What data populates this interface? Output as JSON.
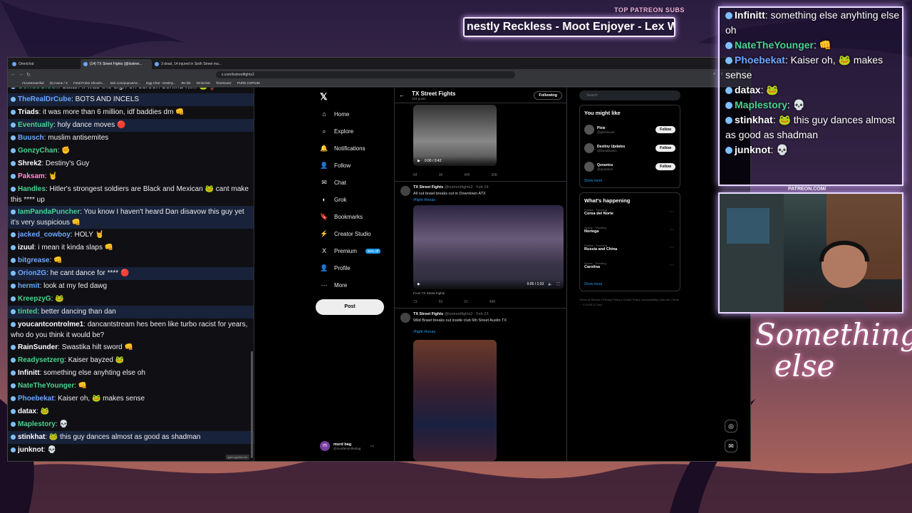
{
  "overlay": {
    "top_subs_label": "TOP PATREON SUBS",
    "ticker_text": "nestly Reckless - Moot Enjoyer - Lex W",
    "patreon_url": "PATREON.COM/",
    "logo_text": "Something else"
  },
  "browser": {
    "tabs": [
      {
        "label": "Omnichat",
        "active": false
      },
      {
        "label": "(14) TX Street Fights (@txstree...",
        "active": true
      },
      {
        "label": "3 dead, 14 injured in Sixth Street ma...",
        "active": false
      }
    ],
    "url": "x.com/txstreetfights2",
    "bookmarks": [
      "r/Livestreamfail",
      "(5) Home / X",
      "Fetal Police Shootin...",
      "kick.com/popout/xs...",
      "Ogg Chat - Destiny...",
      "the list",
      "Omnichat",
      "TimeGuesr",
      "PURE COPIUM"
    ]
  },
  "chat": {
    "messages": [
      {
        "user": "CondoSloth",
        "color": "#4ad28f",
        "text": "datax it was the sign on screen behind him 🐸🦆",
        "alt": false
      },
      {
        "user": "TheRealDrCube",
        "color": "#6aa8ff",
        "text": "BOTS AND INCELS",
        "alt": true
      },
      {
        "user": "Triads",
        "color": "#ffffff",
        "text": "it was more than 6 million, idf baddies dm 👊",
        "alt": false
      },
      {
        "user": "Eventually",
        "color": "#4ad28f",
        "text": "holy dance moves 🔴",
        "alt": true
      },
      {
        "user": "Buusch",
        "color": "#6aa8ff",
        "text": "muslim antisemites",
        "alt": false
      },
      {
        "user": "GonzyChan",
        "color": "#4ad28f",
        "text": "✊",
        "alt": false
      },
      {
        "user": "Shrek2",
        "color": "#ffffff",
        "text": "Destiny's Guy",
        "alt": false
      },
      {
        "user": "Paksam",
        "color": "#ff8fd0",
        "text": "🤘",
        "alt": false
      },
      {
        "user": "Handles",
        "color": "#4ad28f",
        "text": "Hitler's strongest soldiers are Black and Mexican 🐸 cant make this **** up",
        "alt": false,
        "wrap": true
      },
      {
        "user": "IamPandaPuncher",
        "color": "#4ad28f",
        "text": "You know I haven't heard Dan disavow this guy yet it's very suspicious 👊",
        "alt": true,
        "wrap": true
      },
      {
        "user": "jacked_cowboy",
        "color": "#6aa8ff",
        "text": "HOLY 🤘",
        "alt": false
      },
      {
        "user": "izuul",
        "color": "#ffffff",
        "text": "i mean it kinda slaps 👊",
        "alt": false
      },
      {
        "user": "bitgrease",
        "color": "#6aa8ff",
        "text": "👊",
        "alt": false
      },
      {
        "user": "Orion2G",
        "color": "#6aa8ff",
        "text": "he cant dance for **** 🔴",
        "alt": true
      },
      {
        "user": "hermit",
        "color": "#6aa8ff",
        "text": "look at my fed dawg",
        "alt": false
      },
      {
        "user": "KreepzyG",
        "color": "#4ad28f",
        "text": "🐸",
        "alt": false
      },
      {
        "user": "tinted",
        "color": "#4ad28f",
        "text": "better dancing than dan",
        "alt": true
      },
      {
        "user": "youcantcontrolme1",
        "color": "#ffffff",
        "text": "dancantstream hes been like turbo racist for years, who do you think it would be?",
        "alt": false,
        "wrap": true
      },
      {
        "user": "RainSunder",
        "color": "#ffffff",
        "text": "Swastika hilt sword 👊",
        "alt": false
      },
      {
        "user": "Readysetzerg",
        "color": "#4ad28f",
        "text": "Kaiser bayzed 🐸",
        "alt": false
      },
      {
        "user": "Infinitt",
        "color": "#ffffff",
        "text": "something else anyhting else oh",
        "alt": false
      },
      {
        "user": "NateTheYounger",
        "color": "#4ad28f",
        "text": "👊",
        "alt": false
      },
      {
        "user": "Phoebekat",
        "color": "#6aa8ff",
        "text": "Kaiser oh, 🐸 makes sense",
        "alt": false
      },
      {
        "user": "datax",
        "color": "#ffffff",
        "text": "🐸",
        "alt": false
      },
      {
        "user": "Maplestory",
        "color": "#4ad28f",
        "text": "💀",
        "alt": false
      },
      {
        "user": "stinkhat",
        "color": "#ffffff",
        "text": "🐸 this guy dances almost as good as shadman",
        "alt": true
      },
      {
        "user": "junknot",
        "color": "#ffffff",
        "text": "💀",
        "alt": false
      }
    ],
    "footer_badge": "gum.sypher.me"
  },
  "x": {
    "nav": [
      "Home",
      "Explore",
      "Notifications",
      "Follow",
      "Chat",
      "Grok",
      "Bookmarks",
      "Creator Studio",
      "Premium",
      "Profile",
      "More"
    ],
    "nav_icons": [
      "⌂",
      "⌕",
      "🔔",
      "👤",
      "✉",
      "◐",
      "🔖",
      "⚡",
      "X",
      "👤",
      "⋯"
    ],
    "premium_badge": "50% off",
    "post_label": "Post",
    "account": {
      "name": "murd bag",
      "handle": "@murdersinthebag",
      "initial": "m"
    },
    "header": {
      "title": "TX Street Fights",
      "posts": "334 posts",
      "following_label": "Following"
    },
    "tweets": [
      {
        "stats": [
          "84",
          "38",
          "445",
          "30K"
        ],
        "time": "0:00 / 0:42"
      },
      {
        "name": "TX Street Fights",
        "handle": "@txstreetfights2 · Feb 24",
        "text": "All out brawl breaks out in Downtown ATX",
        "tags": "#fight #texas",
        "time": "0:05 / 1:33",
        "from": "From TX Street Fights",
        "stats": [
          "73",
          "59",
          "91",
          "48K"
        ]
      },
      {
        "name": "TX Street Fights",
        "handle": "@txstreetfights2 · Feb 23",
        "text": "Wild Brawl breaks out inside club 6th Street Austin TX",
        "tags": "#fight #texas"
      }
    ],
    "search_placeholder": "Search",
    "you_might_like": {
      "title": "You might like",
      "accounts": [
        {
          "name": "Pixie",
          "handle": "@pixielovee",
          "follow": "Follow"
        },
        {
          "name": "Destiny Updates",
          "handle": "@DestiDanko",
          "follow": "Follow"
        },
        {
          "name": "Qorantos",
          "handle": "@qorantos",
          "follow": "Follow"
        }
      ],
      "show_more": "Show more"
    },
    "whats_happening": {
      "title": "What's happening",
      "trends": [
        {
          "cat": "Politics · Trending",
          "name": "Corea del Norte"
        },
        {
          "cat": "Sports · Trending",
          "name": "Noriega"
        },
        {
          "cat": "Politics · Trending",
          "name": "Russia and China"
        },
        {
          "cat": "Sports · Trending",
          "name": "Carolina"
        }
      ],
      "show_more": "Show more"
    },
    "footer": "Terms of Service | Privacy Policy | Cookie Policy | Accessibility | Ads info | More ··· © 2025 X Corp."
  },
  "overlay_chat": [
    {
      "user": "Infinitt",
      "text": "something else anyhting else oh",
      "color": "#ffffff"
    },
    {
      "user": "NateTheYounger",
      "text": "👊",
      "color": "#4ad28f"
    },
    {
      "user": "Phoebekat",
      "text": "Kaiser oh, 🐸 makes sense",
      "color": "#6aa8ff"
    },
    {
      "user": "datax",
      "text": "🐸",
      "color": "#ffffff"
    },
    {
      "user": "Maplestory",
      "text": "💀",
      "color": "#4ad28f"
    },
    {
      "user": "stinkhat",
      "text": "🐸 this guy dances almost as good as shadman",
      "color": "#ffffff"
    },
    {
      "user": "junknot",
      "text": "💀",
      "color": "#ffffff"
    }
  ]
}
